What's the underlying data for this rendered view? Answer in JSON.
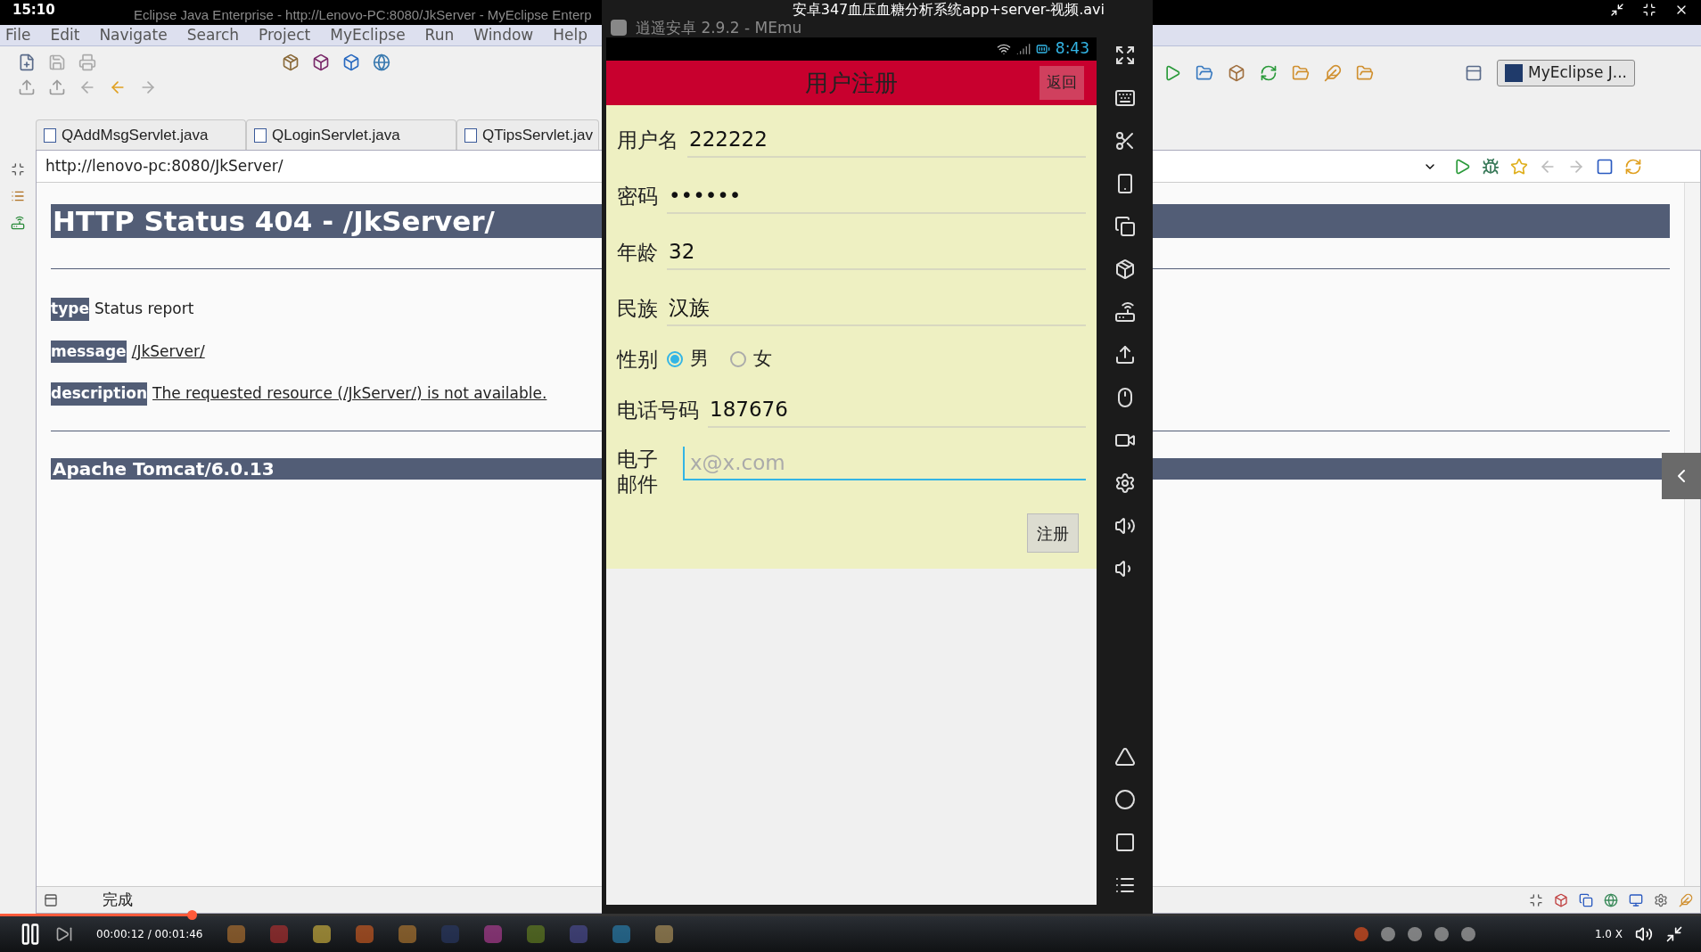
{
  "video_player": {
    "clock": "15:10",
    "title": "安卓347血压血糖分析系统app+server-视频.avi",
    "time": "00:00:12 / 00:01:46",
    "speed": "1.0 X",
    "progress": {
      "level": 0.113
    }
  },
  "ide": {
    "window_title": "Eclipse Java Enterprise - http://Lenovo-PC:8080/JkServer - MyEclipse Enterp",
    "menu": [
      "File",
      "Edit",
      "Navigate",
      "Search",
      "Project",
      "MyEclipse",
      "Run",
      "Window",
      "Help"
    ],
    "perspective": "MyEclipse J...",
    "tabs": [
      {
        "label": "QAddMsgServlet.java",
        "selected": false
      },
      {
        "label": "QLoginServlet.java",
        "selected": false
      },
      {
        "label": "QTipsServlet.jav",
        "selected": false
      }
    ],
    "url": "http://lenovo-pc:8080/JkServer/",
    "page": {
      "heading": "HTTP Status 404 - /JkServer/",
      "rows": [
        {
          "label": "type",
          "value": "Status report",
          "kind": "text"
        },
        {
          "label": "message",
          "value": "/JkServer/",
          "kind": "link"
        },
        {
          "label": "description",
          "value": "The requested resource (/JkServer/) is not available.",
          "kind": "link"
        }
      ],
      "footer": "Apache Tomcat/6.0.13"
    },
    "status": "完成"
  },
  "emulator": {
    "window_title": "逍遥安卓 2.9.2 - MEmu",
    "clock": "8:43",
    "screen_title": "用户注册",
    "back_button": "返回",
    "fields": [
      {
        "kind": "text",
        "label": "用户名",
        "value": "222222"
      },
      {
        "kind": "text",
        "label": "密码",
        "value": "••••••"
      },
      {
        "kind": "text",
        "label": "年龄",
        "value": "32"
      },
      {
        "kind": "text",
        "label": "民族",
        "value": "汉族"
      },
      {
        "kind": "radio",
        "label": "性别",
        "options": [
          {
            "label": "男",
            "selected": true
          },
          {
            "label": "女",
            "selected": false
          }
        ]
      },
      {
        "kind": "text",
        "label": "电话号码",
        "value": "187676"
      },
      {
        "kind": "email",
        "label": "电子邮件",
        "placeholder": "x@x.com",
        "focused": true
      }
    ],
    "submit": "注册"
  }
}
